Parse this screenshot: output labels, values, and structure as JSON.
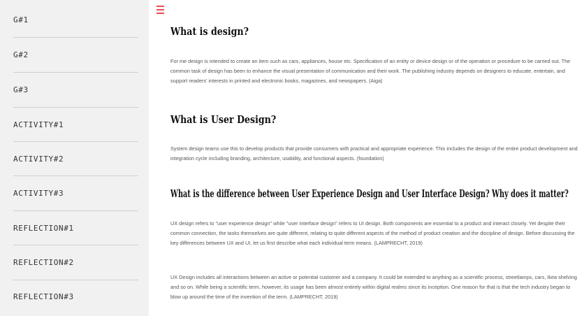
{
  "sidebar": {
    "items": [
      {
        "label": "G#1"
      },
      {
        "label": "G#2"
      },
      {
        "label": "G#3"
      },
      {
        "label": "ACTIVITY#1"
      },
      {
        "label": "ACTIVITY#2"
      },
      {
        "label": "ACTIVITY#3"
      },
      {
        "label": "REFLECTION#1"
      },
      {
        "label": "REFLECTION#2"
      },
      {
        "label": "REFLECTION#3"
      }
    ]
  },
  "colors": {
    "accent": "#e94e4e",
    "sidebar_bg": "#f1f1f1",
    "text": "#555555"
  },
  "icons": {
    "menu": "hamburger-icon"
  },
  "main": {
    "sections": [
      {
        "heading": "What is design?",
        "paragraphs": [
          "For me design is intended to create an item such as cars, appliances, house etc. Specification of an entity or device design or of the operation or procedure to be carried out. The common task of design has been to enhance the visual presentation of communication and their work. The publishing industry depends on designers to educate, entertain, and support readers' interests in printed and electronic books, magazines, and newspapers. (Aiga)"
        ]
      },
      {
        "heading": "What is User Design?",
        "paragraphs": [
          "System design teams use this to develop products that provide consumers with practical and appropriate experience. This includes the design of the entire product development and integration cycle including branding, architecture, usability, and functional aspects. (foundation)"
        ]
      },
      {
        "heading": "What is the difference between User Experience Design and User Interface Design? Why does it matter?",
        "paragraphs": [
          "UX design refers to \"user experience design\" while \"user interface design\" refers to UI design. Both components are essential to a product and interact closely. Yet despite their common connection, the tasks themselves are quite different, relating to quite different aspects of the method of product creation and the discipline of design. Before discussing the key differences between UX and UI, let us first describe what each individual term means. (LAMPRECHT, 2019)",
          "UX Design includes all interactions between an active or potential customer and a company. It could be extended to anything as a scientific process, streetlamps, cars, Ikea shelving and so on. While being a scientific term, however, its usage has been almost entirely within digital realms since its inception. One reason for that is that the tech industry began to blow up around the time of the invention of the term. (LAMPRECHT, 2019)"
        ]
      }
    ]
  }
}
